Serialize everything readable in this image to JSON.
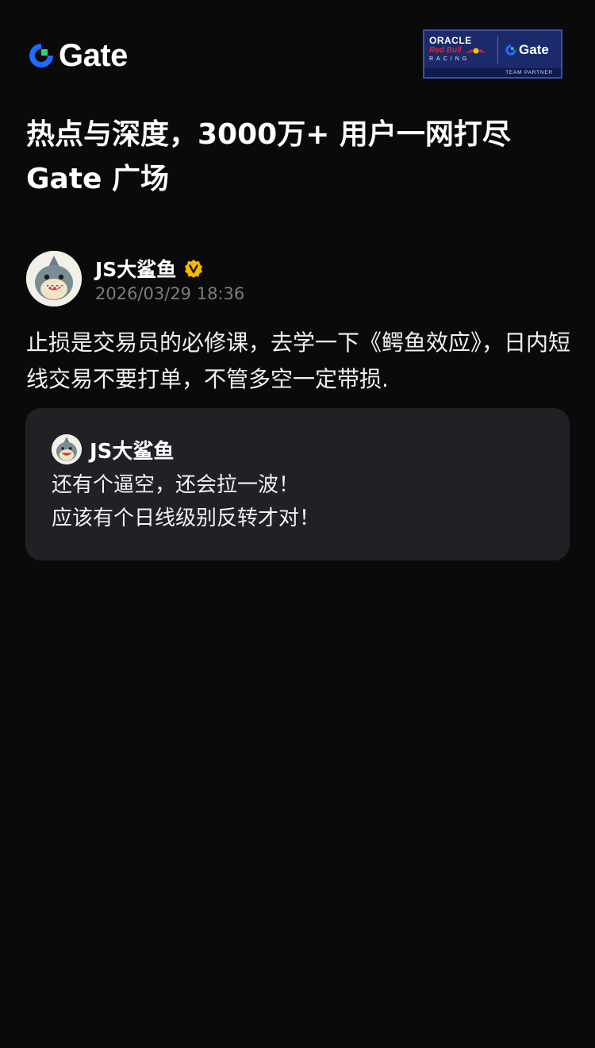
{
  "header": {
    "brand": "Gate",
    "brand_color": "#1f6bff",
    "partner": {
      "oracle": "ORACLE",
      "redbull": "Red Bull",
      "racing": "RACING",
      "gate": "Gate",
      "footer": "TEAM PARTNER"
    }
  },
  "headline": "热点与深度，3000万+ 用户一网打尽 Gate 广场",
  "post": {
    "author": {
      "name": "JS大鲨鱼",
      "verified_color": "#f5b800",
      "date": "2026/03/29 18:36"
    },
    "body": "止损是交易员的必修课，去学一下《鳄鱼效应》，日内短线交易不要打单，不管多空一定带损.",
    "quote": {
      "author": "JS大鲨鱼",
      "text": "还有个逼空，还会拉一波！\n应该有个日线级别反转才对！"
    }
  }
}
